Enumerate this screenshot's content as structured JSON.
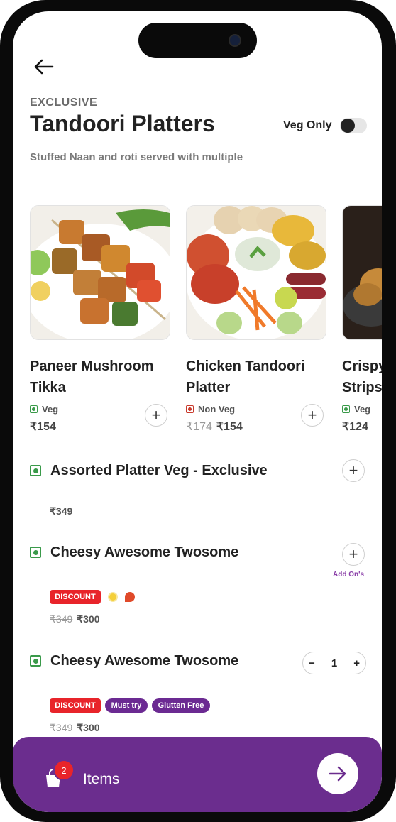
{
  "header": {
    "eyebrow": "EXCLUSIVE",
    "title": "Tandoori Platters",
    "veg_only_label": "Veg Only",
    "veg_only_on": false,
    "subtitle": "Stuffed Naan and roti served with multiple"
  },
  "featured": [
    {
      "name_line1": "Paneer Mushroom",
      "name_line2": "Tikka",
      "diet": "Veg",
      "price": "₹154",
      "old_price": ""
    },
    {
      "name_line1": "Chicken Tandoori",
      "name_line2": "Platter",
      "diet": "Non Veg",
      "price": "₹154",
      "old_price": "₹174"
    },
    {
      "name_line1": "Crispy",
      "name_line2": "Strips",
      "diet": "Veg",
      "price": "₹124",
      "old_price": ""
    }
  ],
  "list": [
    {
      "name": "Assorted Platter Veg - Exclusive",
      "price": "₹349",
      "old_price": ""
    },
    {
      "name": "Cheesy Awesome Twosome",
      "price": "₹300",
      "old_price": "₹349",
      "badge": "DISCOUNT",
      "addons_label": "Add On's"
    },
    {
      "name": "Cheesy Awesome Twosome",
      "price": "₹300",
      "old_price": "₹349",
      "badges": [
        "DISCOUNT",
        "Must try",
        "Glutten Free"
      ],
      "quantity": "1"
    }
  ],
  "cart": {
    "count": "2",
    "label": "Items"
  },
  "colors": {
    "brand": "#6b2d8e",
    "discount": "#e8242a",
    "veg": "#3a9a4a",
    "nonveg": "#c8392b"
  },
  "icons": [
    "back-arrow-icon",
    "plus-icon",
    "minus-icon",
    "shopping-bag-icon",
    "arrow-right-icon"
  ]
}
